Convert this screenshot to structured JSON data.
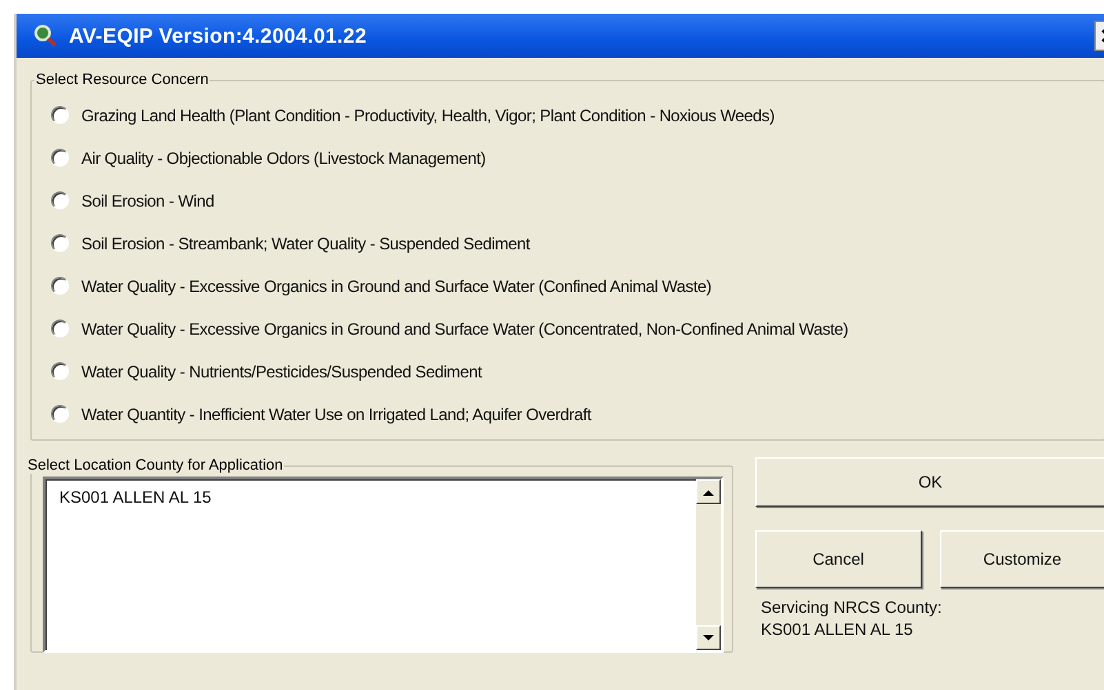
{
  "window": {
    "title": "AV-EQIP Version:4.2004.01.22"
  },
  "resource_concern": {
    "legend": "Select Resource Concern",
    "options": [
      {
        "label": "Grazing Land Health (Plant Condition - Productivity, Health, Vigor; Plant Condition - Noxious Weeds)",
        "selected": false
      },
      {
        "label": "Air Quality - Objectionable Odors (Livestock Management)",
        "selected": false
      },
      {
        "label": "Soil Erosion - Wind",
        "selected": false
      },
      {
        "label": "Soil Erosion - Streambank; Water Quality - Suspended Sediment",
        "selected": false
      },
      {
        "label": "Water Quality - Excessive Organics in Ground and Surface Water (Confined Animal Waste)",
        "selected": false
      },
      {
        "label": "Water Quality - Excessive Organics in Ground and Surface Water (Concentrated, Non-Confined Animal Waste)",
        "selected": false
      },
      {
        "label": "Water Quality - Nutrients/Pesticides/Suspended Sediment",
        "selected": false
      },
      {
        "label": "Water Quantity - Inefficient Water Use on Irrigated Land; Aquifer Overdraft",
        "selected": false
      }
    ]
  },
  "location": {
    "legend": "Select Location County for Application",
    "items": [
      {
        "label": "KS001 ALLEN AL 15",
        "selected": false
      }
    ]
  },
  "buttons": {
    "ok": "OK",
    "cancel": "Cancel",
    "customize": "Customize"
  },
  "servicing": {
    "label": "Servicing NRCS County:",
    "value": "KS001 ALLEN AL 15"
  }
}
